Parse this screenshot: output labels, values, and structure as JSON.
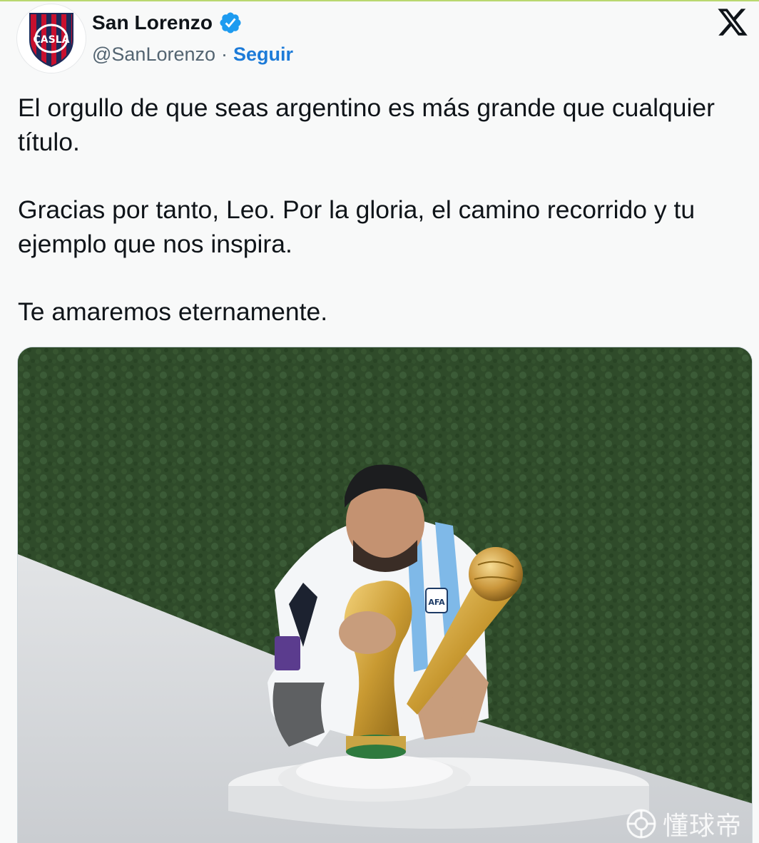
{
  "account": {
    "display_name": "San Lorenzo",
    "handle": "@SanLorenzo",
    "separator": "·",
    "follow_label": "Seguir",
    "avatar_logo_text": "CASLA",
    "verified": true
  },
  "tweet": {
    "paragraphs": [
      "El orgullo de que seas argentino es más grande que cualquier título.",
      "Gracias por tanto, Leo. Por la gloria, el camino recorrido y tu ejemplo que nos inspira.",
      "Te amaremos eternamente."
    ]
  },
  "media": {
    "watermark_text": "懂球帝",
    "shirt_badge": "AFA"
  },
  "colors": {
    "link_blue": "#1d7bd8",
    "verified_blue": "#1d9bf0",
    "text": "#0f1419",
    "secondary_text": "#536471",
    "club_red": "#c8102e",
    "club_navy": "#1b2a5a"
  },
  "icons": {
    "close": "x-logo-icon",
    "verified": "verified-badge-icon",
    "watermark": "watermark-logo-icon"
  }
}
